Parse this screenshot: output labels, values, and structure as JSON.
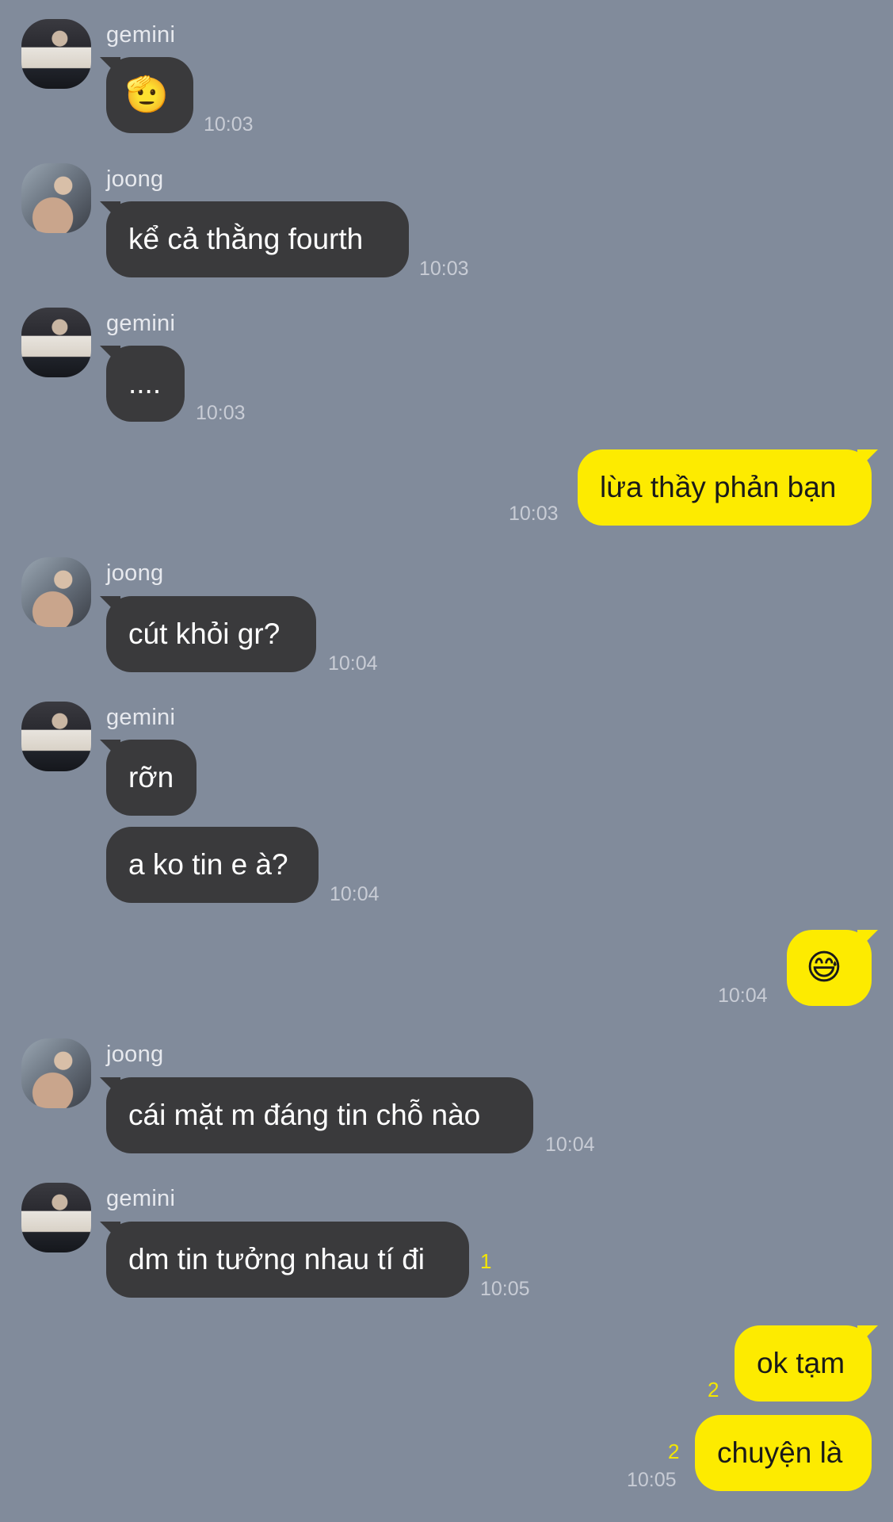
{
  "messages": [
    {
      "sender": "gemini",
      "text": "🫡",
      "time": "10:03"
    },
    {
      "sender": "joong",
      "text": "kể cả thằng fourth",
      "time": "10:03"
    },
    {
      "sender": "gemini",
      "text": "....",
      "time": "10:03"
    },
    {
      "sender": "me",
      "text": "lừa thầy phản bạn",
      "time": "10:03"
    },
    {
      "sender": "joong",
      "text": "cút khỏi gr?",
      "time": "10:04"
    },
    {
      "sender": "gemini",
      "text": "rỡn"
    },
    {
      "sender": "gemini",
      "text": "a ko tin e à?",
      "time": "10:04"
    },
    {
      "sender": "me",
      "text": "😅",
      "time": "10:04"
    },
    {
      "sender": "joong",
      "text": "cái mặt m đáng tin chỗ nào",
      "time": "10:04"
    },
    {
      "sender": "gemini",
      "text": "dm tin tưởng nhau tí đi",
      "unread": "1",
      "time": "10:05"
    },
    {
      "sender": "me",
      "text": "ok tạm",
      "unread": "2"
    },
    {
      "sender": "me",
      "text": "chuyện là",
      "unread": "2",
      "time": "10:05"
    }
  ],
  "names": {
    "gemini": "gemini",
    "joong": "joong"
  },
  "colors": {
    "background": "#818b9b",
    "incoming_bubble": "#3a3a3c",
    "outgoing_bubble": "#fdeb00",
    "unread_count": "#f4e600"
  }
}
